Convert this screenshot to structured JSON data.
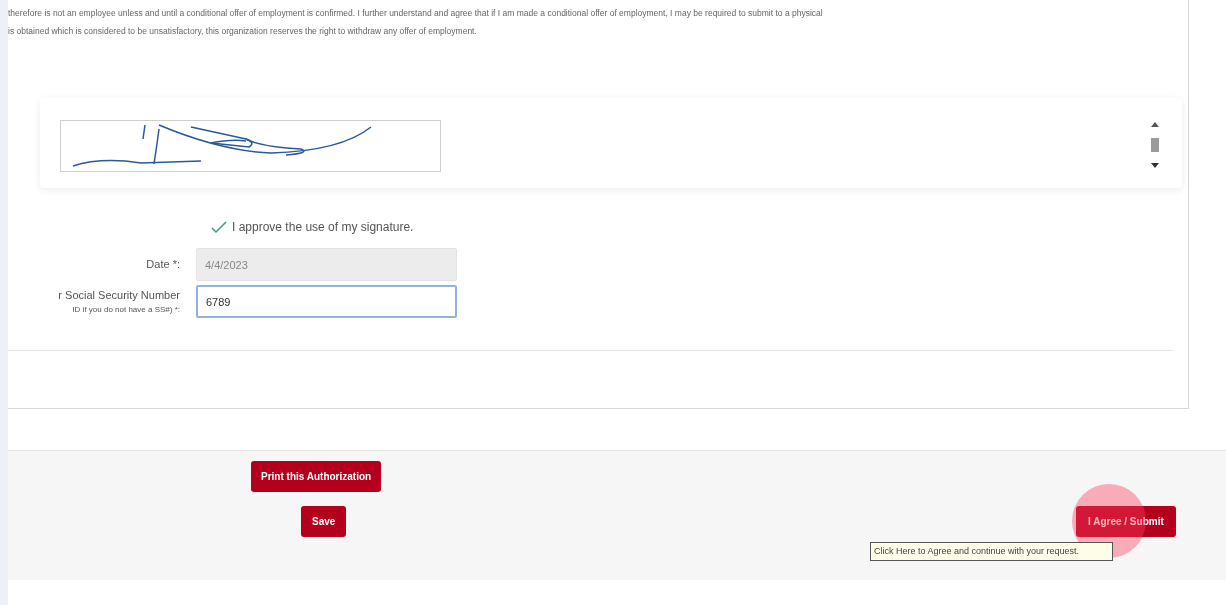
{
  "consent_text": [
    "therefore is not an employee unless and until a conditional offer of employment is confirmed. I further understand and agree that if I am made a conditional offer of employment, I may be required to submit to a physical",
    "is obtained which is considered to be unsatisfactory, this organization reserves the right to withdraw any offer of employment."
  ],
  "signature": {
    "kind": "drawing"
  },
  "approve": {
    "label": "I approve the use of my signature.",
    "checked": true
  },
  "fields": [
    {
      "label": "Date *:",
      "value": "4/4/2023",
      "disabled": true,
      "focused": false
    },
    {
      "label": "r Social Security Number",
      "sublabel": "ID if you do not have a SS#) *:",
      "value": "6789",
      "disabled": false,
      "focused": true
    }
  ],
  "buttons": {
    "print": "Print this Authorization",
    "save": "Save",
    "submit": "I Agree / Submit"
  },
  "tooltip": "Click Here to Agree and continue with your request."
}
